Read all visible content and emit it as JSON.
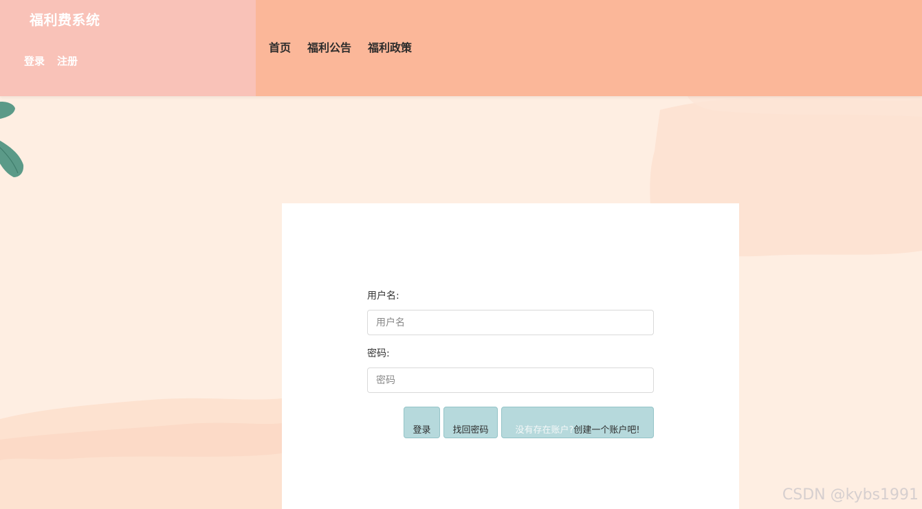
{
  "header": {
    "brand_title": "福利费系统",
    "auth": {
      "login": "登录",
      "register": "注册"
    },
    "nav": [
      "首页",
      "福利公告",
      "福利政策"
    ]
  },
  "login_form": {
    "username": {
      "label": "用户名:",
      "placeholder": "用户名"
    },
    "password": {
      "label": "密码:",
      "placeholder": "密码"
    },
    "buttons": {
      "login": "登录",
      "forgot_password": "找回密码",
      "register_prefix": "没有存在账户?",
      "register_action": "创建一个账户吧!"
    }
  },
  "watermark": "CSDN @kybs1991",
  "colors": {
    "brand_panel": "#f9c2b8",
    "nav_panel": "#fbb799",
    "page_bg": "#feeee2",
    "button_bg": "#b6d9dc",
    "leaf": "#5b9a88"
  },
  "icons": [
    "leaf-decoration-icon",
    "text-cursor-icon"
  ]
}
